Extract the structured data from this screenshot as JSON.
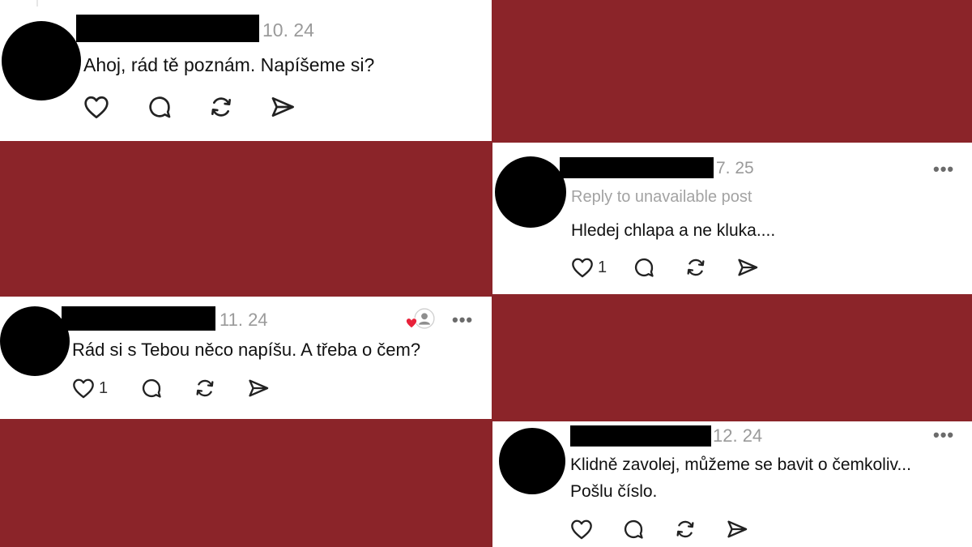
{
  "comments": [
    {
      "date": "10. 24",
      "lines": [
        "Ahoj, rád tě poznám. Napíšeme si?"
      ],
      "like_count": "",
      "icons": [
        "heart-icon",
        "reply-icon",
        "repost-icon",
        "share-icon"
      ]
    },
    {
      "date": "7. 25",
      "reply_note": "Reply to unavailable post",
      "lines": [
        "Hledej chlapa a ne kluka...."
      ],
      "like_count": "1",
      "more": "•••",
      "icons": [
        "heart-icon",
        "reply-icon",
        "repost-icon",
        "share-icon"
      ]
    },
    {
      "date": "11. 24",
      "lines": [
        "Rád si s Tebou něco napíšu. A třeba o čem?"
      ],
      "like_count": "1",
      "more": "•••",
      "liked_by_author": true,
      "icons": [
        "heart-icon",
        "reply-icon",
        "repost-icon",
        "share-icon"
      ]
    },
    {
      "date": "12. 24",
      "lines": [
        "Klidně zavolej, můžeme se bavit o čemkoliv...",
        "Pošlu číslo."
      ],
      "like_count": "",
      "more": "•••",
      "icons": [
        "heart-icon",
        "reply-icon",
        "repost-icon",
        "share-icon"
      ]
    }
  ],
  "colors": {
    "background": "#8b2429",
    "panel": "#ffffff",
    "muted_text": "#9a9a9a",
    "liked_heart": "#e8213a"
  }
}
